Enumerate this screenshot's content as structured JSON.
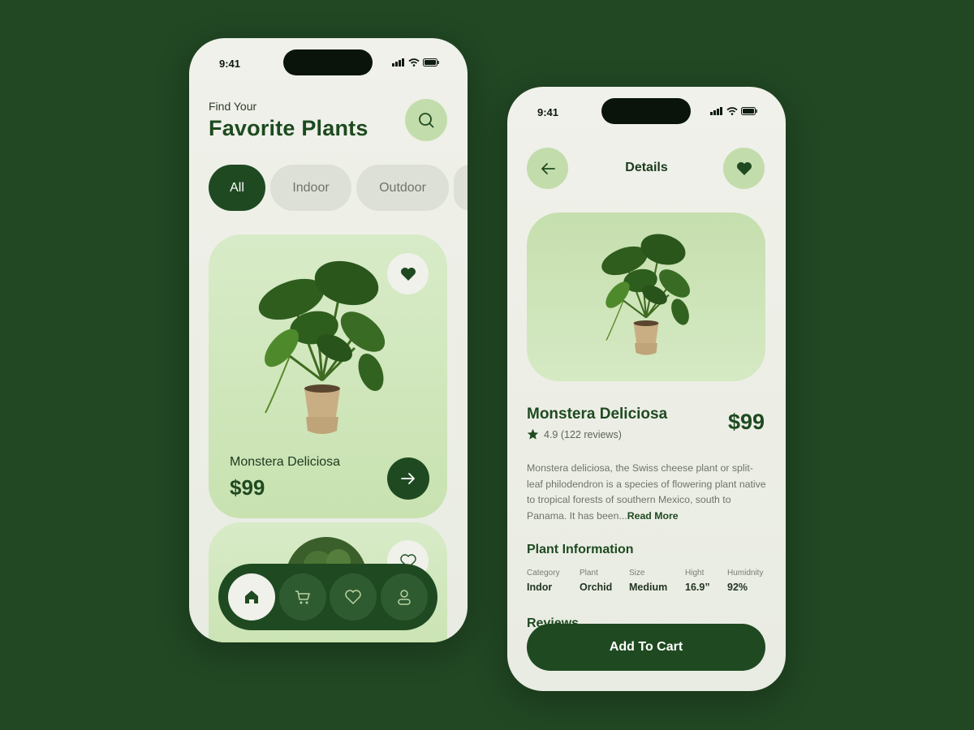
{
  "home": {
    "status_time": "9:41",
    "greeting": "Find Your",
    "title": "Favorite Plants",
    "categories": [
      "All",
      "Indoor",
      "Outdoor"
    ],
    "card": {
      "name": "Monstera Deliciosa",
      "price": "$99"
    }
  },
  "details": {
    "status_time": "9:41",
    "title": "Details",
    "plant_name": "Monstera Deliciosa",
    "rating": "4.9 (122 reviews)",
    "price": "$99",
    "description": "Monstera deliciosa, the Swiss cheese plant or split-leaf philodendron is a species of flowering plant native to tropical forests of southern Mexico, south to Panama. It has been...",
    "read_more": "Read More",
    "info_title": "Plant Information",
    "info": [
      {
        "label": "Category",
        "value": "Indor"
      },
      {
        "label": "Plant",
        "value": "Orchid"
      },
      {
        "label": "Size",
        "value": "Medium"
      },
      {
        "label": "Hight",
        "value": "16.9”"
      },
      {
        "label": "Humidnity",
        "value": "92%"
      }
    ],
    "reviews_title": "Reviews",
    "cta": "Add To Cart"
  },
  "colors": {
    "background": "#214723",
    "primary": "#1f4a21",
    "accent_light": "#c3dcab",
    "card": "#d0e6bc"
  },
  "icons": [
    "search-icon",
    "heart-icon",
    "arrow-right-icon",
    "arrow-left-icon",
    "home-icon",
    "cart-icon",
    "user-icon",
    "star-icon",
    "signal-icon",
    "wifi-icon",
    "battery-icon"
  ]
}
